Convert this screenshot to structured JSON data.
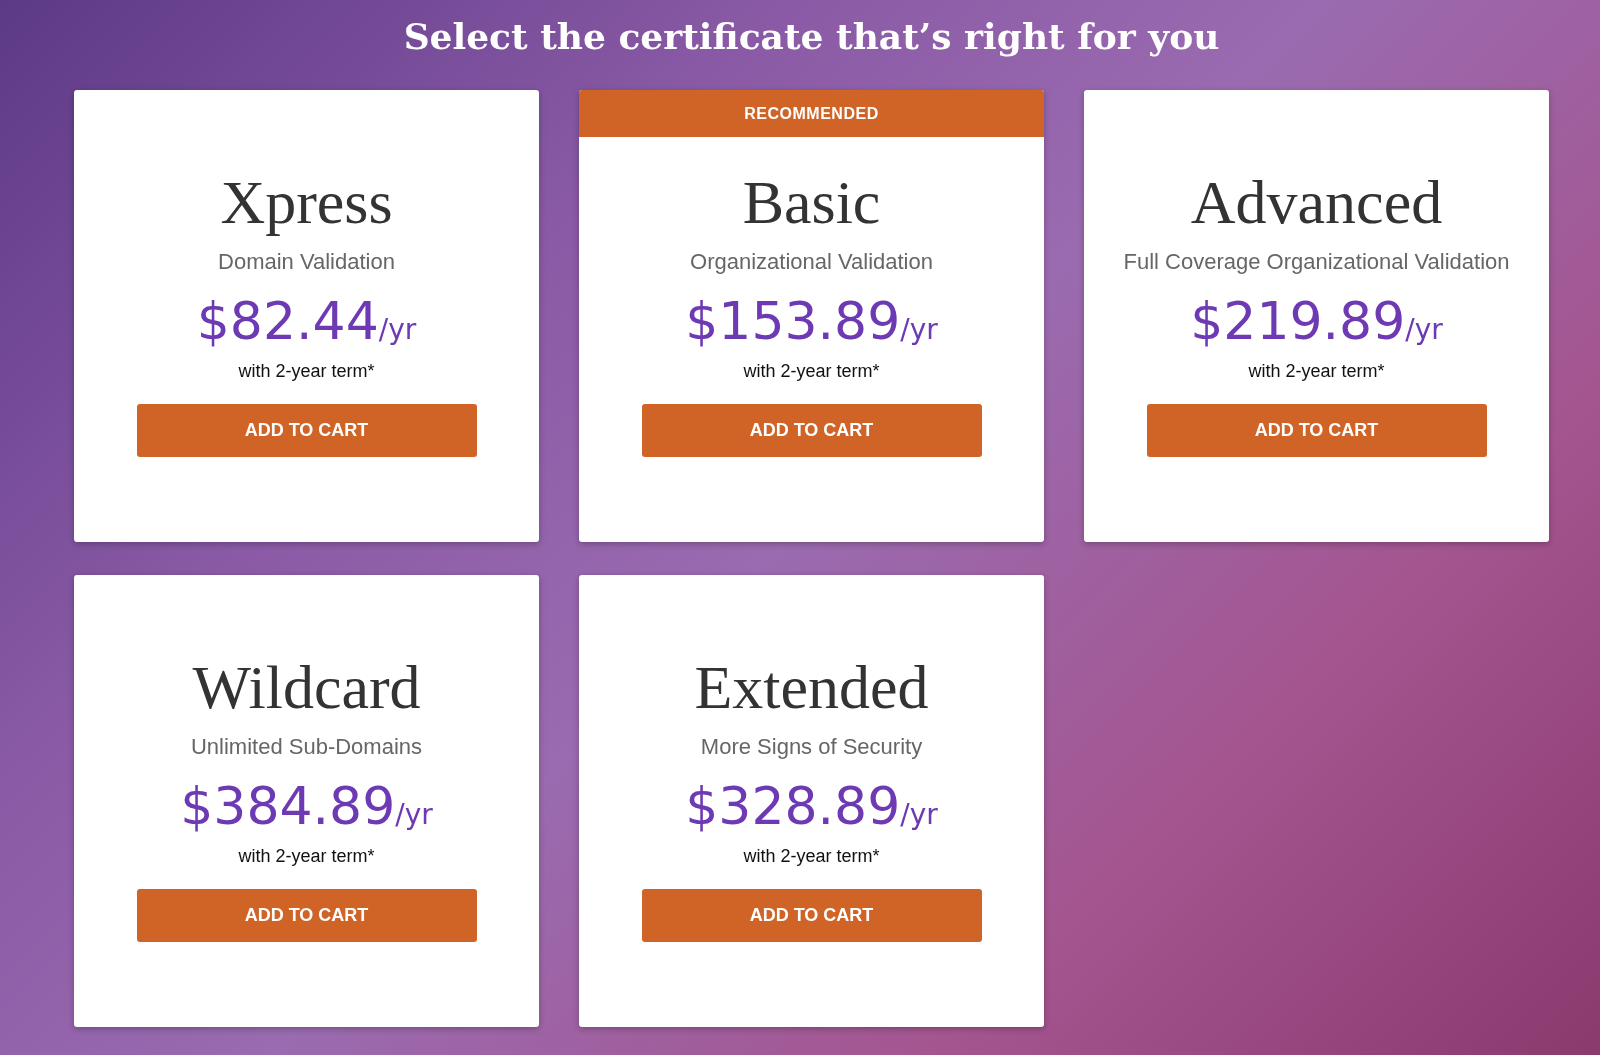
{
  "heading": "Select the certificate that’s right for you",
  "plans": [
    {
      "name": "Xpress",
      "subtitle": "Domain Validation",
      "price": "$82.44",
      "unit": "/yr",
      "term": "with 2-year term*",
      "button": "ADD TO CART"
    },
    {
      "badge": "RECOMMENDED",
      "name": "Basic",
      "subtitle": "Organizational Validation",
      "price": "$153.89",
      "unit": "/yr",
      "term": "with 2-year term*",
      "button": "ADD TO CART"
    },
    {
      "name": "Advanced",
      "subtitle": "Full Coverage Organizational Validation",
      "price": "$219.89",
      "unit": "/yr",
      "term": "with 2-year term*",
      "button": "ADD TO CART"
    },
    {
      "name": "Wildcard",
      "subtitle": "Unlimited Sub-Domains",
      "price": "$384.89",
      "unit": "/yr",
      "term": "with 2-year term*",
      "button": "ADD TO CART"
    },
    {
      "name": "Extended",
      "subtitle": "More Signs of Security",
      "price": "$328.89",
      "unit": "/yr",
      "term": "with 2-year term*",
      "button": "ADD TO CART"
    }
  ]
}
